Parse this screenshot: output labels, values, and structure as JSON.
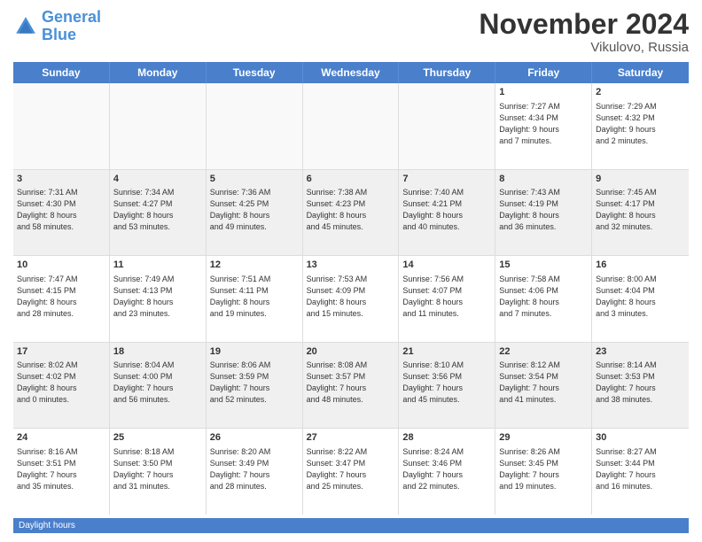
{
  "logo": {
    "line1": "General",
    "line2": "Blue"
  },
  "title": "November 2024",
  "location": "Vikulovo, Russia",
  "days_header": [
    "Sunday",
    "Monday",
    "Tuesday",
    "Wednesday",
    "Thursday",
    "Friday",
    "Saturday"
  ],
  "footer": "Daylight hours",
  "weeks": [
    [
      {
        "day": "",
        "info": ""
      },
      {
        "day": "",
        "info": ""
      },
      {
        "day": "",
        "info": ""
      },
      {
        "day": "",
        "info": ""
      },
      {
        "day": "",
        "info": ""
      },
      {
        "day": "1",
        "info": "Sunrise: 7:27 AM\nSunset: 4:34 PM\nDaylight: 9 hours\nand 7 minutes."
      },
      {
        "day": "2",
        "info": "Sunrise: 7:29 AM\nSunset: 4:32 PM\nDaylight: 9 hours\nand 2 minutes."
      }
    ],
    [
      {
        "day": "3",
        "info": "Sunrise: 7:31 AM\nSunset: 4:30 PM\nDaylight: 8 hours\nand 58 minutes."
      },
      {
        "day": "4",
        "info": "Sunrise: 7:34 AM\nSunset: 4:27 PM\nDaylight: 8 hours\nand 53 minutes."
      },
      {
        "day": "5",
        "info": "Sunrise: 7:36 AM\nSunset: 4:25 PM\nDaylight: 8 hours\nand 49 minutes."
      },
      {
        "day": "6",
        "info": "Sunrise: 7:38 AM\nSunset: 4:23 PM\nDaylight: 8 hours\nand 45 minutes."
      },
      {
        "day": "7",
        "info": "Sunrise: 7:40 AM\nSunset: 4:21 PM\nDaylight: 8 hours\nand 40 minutes."
      },
      {
        "day": "8",
        "info": "Sunrise: 7:43 AM\nSunset: 4:19 PM\nDaylight: 8 hours\nand 36 minutes."
      },
      {
        "day": "9",
        "info": "Sunrise: 7:45 AM\nSunset: 4:17 PM\nDaylight: 8 hours\nand 32 minutes."
      }
    ],
    [
      {
        "day": "10",
        "info": "Sunrise: 7:47 AM\nSunset: 4:15 PM\nDaylight: 8 hours\nand 28 minutes."
      },
      {
        "day": "11",
        "info": "Sunrise: 7:49 AM\nSunset: 4:13 PM\nDaylight: 8 hours\nand 23 minutes."
      },
      {
        "day": "12",
        "info": "Sunrise: 7:51 AM\nSunset: 4:11 PM\nDaylight: 8 hours\nand 19 minutes."
      },
      {
        "day": "13",
        "info": "Sunrise: 7:53 AM\nSunset: 4:09 PM\nDaylight: 8 hours\nand 15 minutes."
      },
      {
        "day": "14",
        "info": "Sunrise: 7:56 AM\nSunset: 4:07 PM\nDaylight: 8 hours\nand 11 minutes."
      },
      {
        "day": "15",
        "info": "Sunrise: 7:58 AM\nSunset: 4:06 PM\nDaylight: 8 hours\nand 7 minutes."
      },
      {
        "day": "16",
        "info": "Sunrise: 8:00 AM\nSunset: 4:04 PM\nDaylight: 8 hours\nand 3 minutes."
      }
    ],
    [
      {
        "day": "17",
        "info": "Sunrise: 8:02 AM\nSunset: 4:02 PM\nDaylight: 8 hours\nand 0 minutes."
      },
      {
        "day": "18",
        "info": "Sunrise: 8:04 AM\nSunset: 4:00 PM\nDaylight: 7 hours\nand 56 minutes."
      },
      {
        "day": "19",
        "info": "Sunrise: 8:06 AM\nSunset: 3:59 PM\nDaylight: 7 hours\nand 52 minutes."
      },
      {
        "day": "20",
        "info": "Sunrise: 8:08 AM\nSunset: 3:57 PM\nDaylight: 7 hours\nand 48 minutes."
      },
      {
        "day": "21",
        "info": "Sunrise: 8:10 AM\nSunset: 3:56 PM\nDaylight: 7 hours\nand 45 minutes."
      },
      {
        "day": "22",
        "info": "Sunrise: 8:12 AM\nSunset: 3:54 PM\nDaylight: 7 hours\nand 41 minutes."
      },
      {
        "day": "23",
        "info": "Sunrise: 8:14 AM\nSunset: 3:53 PM\nDaylight: 7 hours\nand 38 minutes."
      }
    ],
    [
      {
        "day": "24",
        "info": "Sunrise: 8:16 AM\nSunset: 3:51 PM\nDaylight: 7 hours\nand 35 minutes."
      },
      {
        "day": "25",
        "info": "Sunrise: 8:18 AM\nSunset: 3:50 PM\nDaylight: 7 hours\nand 31 minutes."
      },
      {
        "day": "26",
        "info": "Sunrise: 8:20 AM\nSunset: 3:49 PM\nDaylight: 7 hours\nand 28 minutes."
      },
      {
        "day": "27",
        "info": "Sunrise: 8:22 AM\nSunset: 3:47 PM\nDaylight: 7 hours\nand 25 minutes."
      },
      {
        "day": "28",
        "info": "Sunrise: 8:24 AM\nSunset: 3:46 PM\nDaylight: 7 hours\nand 22 minutes."
      },
      {
        "day": "29",
        "info": "Sunrise: 8:26 AM\nSunset: 3:45 PM\nDaylight: 7 hours\nand 19 minutes."
      },
      {
        "day": "30",
        "info": "Sunrise: 8:27 AM\nSunset: 3:44 PM\nDaylight: 7 hours\nand 16 minutes."
      }
    ]
  ]
}
